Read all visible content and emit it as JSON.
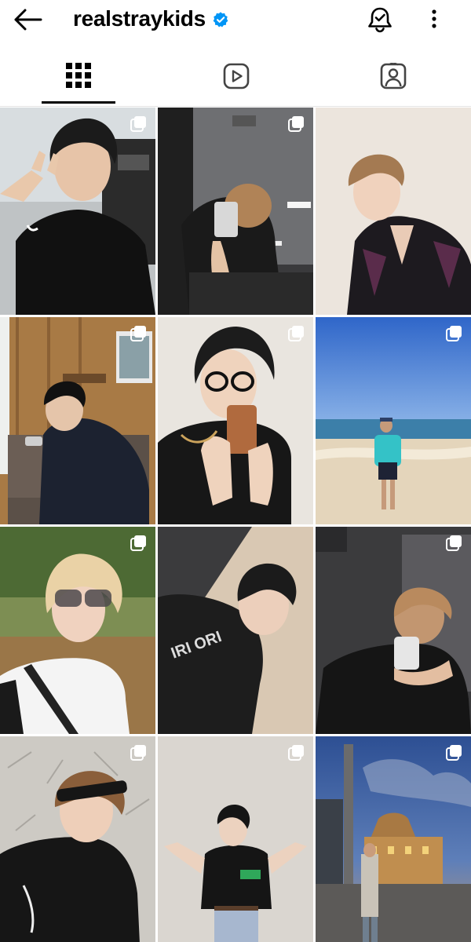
{
  "app": "Instagram",
  "header": {
    "username": "realstraykids",
    "verified": true,
    "back_icon": "arrow-left-icon",
    "notifications_icon": "bell-check-icon",
    "more_icon": "more-vertical-icon"
  },
  "tabs": [
    {
      "id": "posts",
      "icon": "grid-icon",
      "active": true
    },
    {
      "id": "reels",
      "icon": "reels-icon",
      "active": false
    },
    {
      "id": "tagged",
      "icon": "tagged-icon",
      "active": false
    }
  ],
  "colors": {
    "verified_blue": "#0095f6",
    "indicator": "#000000",
    "text": "#000000"
  },
  "posts": [
    {
      "id": 1,
      "multi": true,
      "description": "selfie with peace sign, black nike shirt"
    },
    {
      "id": 2,
      "multi": true,
      "description": "mirror selfie under ceiling lights"
    },
    {
      "id": 3,
      "multi": false,
      "description": "portrait in embroidered black jacket"
    },
    {
      "id": 4,
      "multi": true,
      "description": "seated in wooden-paneled room, denim jacket"
    },
    {
      "id": 5,
      "multi": true,
      "description": "mirror selfie with glasses and orange phone"
    },
    {
      "id": 6,
      "multi": true,
      "description": "on sandy beach with teal towel"
    },
    {
      "id": 7,
      "multi": true,
      "description": "blonde hair with sunglasses outdoors"
    },
    {
      "id": 8,
      "multi": false,
      "description": "lying down in black graphic hoodie"
    },
    {
      "id": 9,
      "multi": true,
      "description": "mirror selfie in black t-shirt"
    },
    {
      "id": 10,
      "multi": true,
      "description": "headband and black hoodie selfie"
    },
    {
      "id": 11,
      "multi": true,
      "description": "standing with arms spread, jeans"
    },
    {
      "id": 12,
      "multi": true,
      "description": "city street at dusk with domed station"
    }
  ]
}
